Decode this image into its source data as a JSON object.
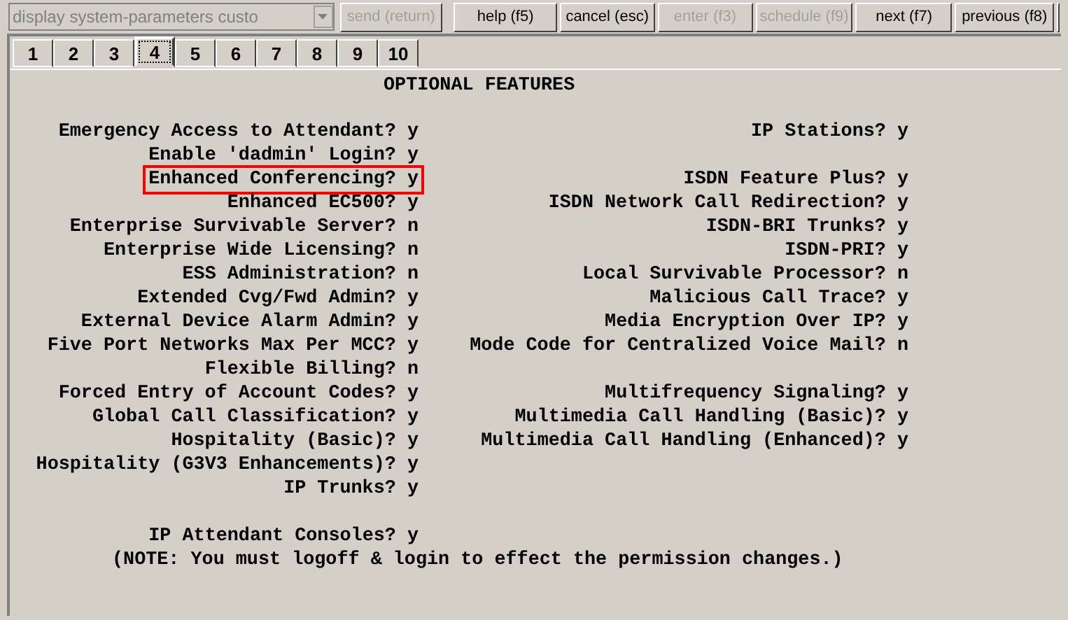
{
  "toolbar": {
    "command": {
      "value": "display system-parameters custo",
      "disabled": true
    },
    "buttons": [
      {
        "label": "send (return)",
        "disabled": true
      },
      {
        "label": "help (f5)",
        "disabled": false
      },
      {
        "label": "cancel (esc)",
        "disabled": false
      },
      {
        "label": "enter (f3)",
        "disabled": true
      },
      {
        "label": "schedule (f9)",
        "disabled": true
      },
      {
        "label": "next (f7)",
        "disabled": false
      },
      {
        "label": "previous (f8)",
        "disabled": false
      }
    ]
  },
  "tabs": [
    {
      "label": "1",
      "selected": false
    },
    {
      "label": "2",
      "selected": false
    },
    {
      "label": "3",
      "selected": false
    },
    {
      "label": "4",
      "selected": true
    },
    {
      "label": "5",
      "selected": false
    },
    {
      "label": "6",
      "selected": false
    },
    {
      "label": "7",
      "selected": false
    },
    {
      "label": "8",
      "selected": false
    },
    {
      "label": "9",
      "selected": false
    },
    {
      "label": "10",
      "selected": false
    }
  ],
  "form": {
    "title": "OPTIONAL FEATURES",
    "rows": [
      {
        "left": {
          "label": "Emergency Access to Attendant?",
          "value": "y",
          "highlighted": false
        },
        "right": {
          "label": "IP Stations?",
          "value": "y",
          "highlighted": false
        }
      },
      {
        "left": {
          "label": "Enable 'dadmin' Login?",
          "value": "y",
          "highlighted": false
        }
      },
      {
        "left": {
          "label": "Enhanced Conferencing?",
          "value": "y",
          "highlighted": true
        },
        "right": {
          "label": "ISDN Feature Plus?",
          "value": "y",
          "highlighted": false
        }
      },
      {
        "left": {
          "label": "Enhanced EC500?",
          "value": "y",
          "highlighted": false
        },
        "right": {
          "label": "ISDN Network Call Redirection?",
          "value": "y",
          "highlighted": false
        }
      },
      {
        "left": {
          "label": "Enterprise Survivable Server?",
          "value": "n",
          "highlighted": false
        },
        "right": {
          "label": "ISDN-BRI Trunks?",
          "value": "y",
          "highlighted": false
        }
      },
      {
        "left": {
          "label": "Enterprise Wide Licensing?",
          "value": "n",
          "highlighted": false
        },
        "right": {
          "label": "ISDN-PRI?",
          "value": "y",
          "highlighted": false
        }
      },
      {
        "left": {
          "label": "ESS Administration?",
          "value": "n",
          "highlighted": false
        },
        "right": {
          "label": "Local Survivable Processor?",
          "value": "n",
          "highlighted": false
        }
      },
      {
        "left": {
          "label": "Extended Cvg/Fwd Admin?",
          "value": "y",
          "highlighted": false
        },
        "right": {
          "label": "Malicious Call Trace?",
          "value": "y",
          "highlighted": false
        }
      },
      {
        "left": {
          "label": "External Device Alarm Admin?",
          "value": "y",
          "highlighted": false
        },
        "right": {
          "label": "Media Encryption Over IP?",
          "value": "y",
          "highlighted": false
        }
      },
      {
        "left": {
          "label": "Five Port Networks Max Per MCC?",
          "value": "y",
          "highlighted": false
        },
        "right": {
          "label": "Mode Code for Centralized Voice Mail?",
          "value": "n",
          "highlighted": false
        }
      },
      {
        "left": {
          "label": "Flexible Billing?",
          "value": "n",
          "highlighted": false
        }
      },
      {
        "left": {
          "label": "Forced Entry of Account Codes?",
          "value": "y",
          "highlighted": false
        },
        "right": {
          "label": "Multifrequency Signaling?",
          "value": "y",
          "highlighted": false
        }
      },
      {
        "left": {
          "label": "Global Call Classification?",
          "value": "y",
          "highlighted": false
        },
        "right": {
          "label": "Multimedia Call Handling (Basic)?",
          "value": "y",
          "highlighted": false
        }
      },
      {
        "left": {
          "label": "Hospitality (Basic)?",
          "value": "y",
          "highlighted": false
        },
        "right": {
          "label": "Multimedia Call Handling (Enhanced)?",
          "value": "y",
          "highlighted": false
        }
      },
      {
        "left": {
          "label": "Hospitality (G3V3 Enhancements)?",
          "value": "y",
          "highlighted": false
        }
      },
      {
        "left": {
          "label": "IP Trunks?",
          "value": "y",
          "highlighted": false
        }
      },
      {},
      {
        "left": {
          "label": "IP Attendant Consoles?",
          "value": "y",
          "highlighted": false
        }
      }
    ],
    "note": "(NOTE: You must logoff & login to effect the permission changes.)"
  }
}
